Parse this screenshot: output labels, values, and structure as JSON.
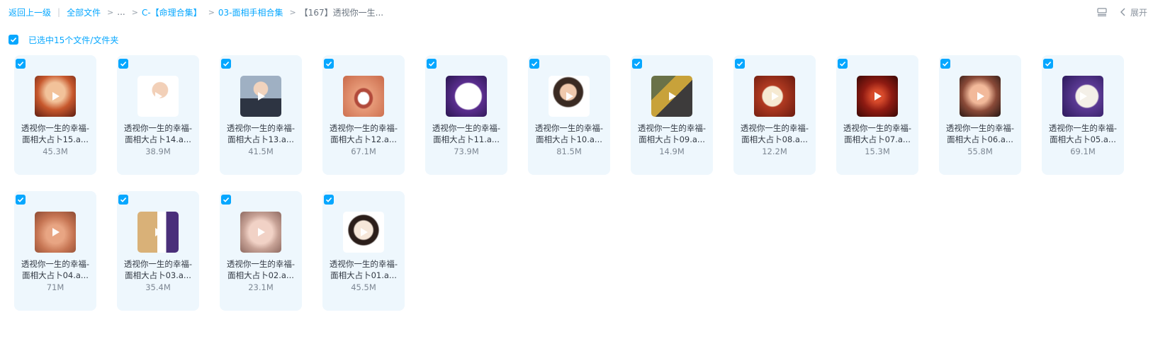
{
  "breadcrumb": {
    "back": "返回上一级",
    "all_files": "全部文件",
    "ellipsis": "...",
    "folder1": "C-【命理合集】",
    "folder2": "03-面相手相合集",
    "current": "【167】透视你一生..."
  },
  "toolbar": {
    "list_view_icon": "list-view-icon",
    "expand_label": "展开"
  },
  "selection": {
    "label": "已选中15个文件/文件夹",
    "checked": true
  },
  "colors": {
    "accent": "#06a7ff",
    "card_bg": "#eef7fd"
  },
  "files": [
    {
      "name": "透视你一生的幸福-面相大占卜15.a...",
      "size": "45.3M"
    },
    {
      "name": "透视你一生的幸福-面相大占卜14.a...",
      "size": "38.9M"
    },
    {
      "name": "透视你一生的幸福-面相大占卜13.a...",
      "size": "41.5M"
    },
    {
      "name": "透视你一生的幸福-面相大占卜12.a...",
      "size": "67.1M"
    },
    {
      "name": "透视你一生的幸福-面相大占卜11.a...",
      "size": "73.9M"
    },
    {
      "name": "透视你一生的幸福-面相大占卜10.a...",
      "size": "81.5M"
    },
    {
      "name": "透视你一生的幸福-面相大占卜09.a...",
      "size": "14.9M"
    },
    {
      "name": "透视你一生的幸福-面相大占卜08.a...",
      "size": "12.2M"
    },
    {
      "name": "透视你一生的幸福-面相大占卜07.a...",
      "size": "15.3M"
    },
    {
      "name": "透视你一生的幸福-面相大占卜06.a...",
      "size": "55.8M"
    },
    {
      "name": "透视你一生的幸福-面相大占卜05.a...",
      "size": "69.1M"
    },
    {
      "name": "透视你一生的幸福-面相大占卜04.a...",
      "size": "71M"
    },
    {
      "name": "透视你一生的幸福-面相大占卜03.a...",
      "size": "35.4M"
    },
    {
      "name": "透视你一生的幸福-面相大占卜02.a...",
      "size": "23.1M"
    },
    {
      "name": "透视你一生的幸福-面相大占卜01.a...",
      "size": "45.5M"
    }
  ]
}
